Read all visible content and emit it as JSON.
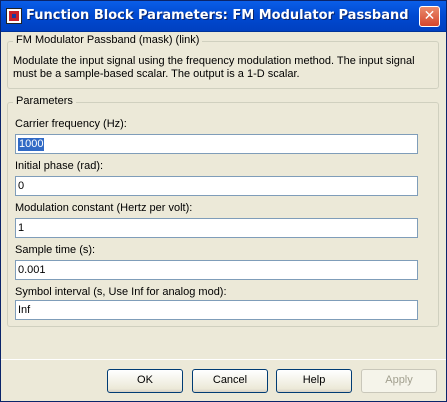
{
  "window": {
    "title": "Function Block Parameters: FM Modulator Passband"
  },
  "mask": {
    "group_title": "FM Modulator Passband (mask) (link)",
    "description": "Modulate the input signal using the frequency modulation method. The input signal must be a sample-based scalar. The output is a 1-D scalar."
  },
  "parameters": {
    "group_title": "Parameters",
    "fields": [
      {
        "label": "Carrier frequency (Hz):",
        "value": "1000"
      },
      {
        "label": "Initial phase (rad):",
        "value": "0"
      },
      {
        "label": "Modulation constant (Hertz per volt):",
        "value": "1"
      },
      {
        "label": "Sample time (s):",
        "value": "0.001"
      },
      {
        "label": "Symbol interval (s, Use Inf for analog mod):",
        "value": "Inf"
      }
    ]
  },
  "buttons": {
    "ok": "OK",
    "cancel": "Cancel",
    "help": "Help",
    "apply": "Apply"
  }
}
